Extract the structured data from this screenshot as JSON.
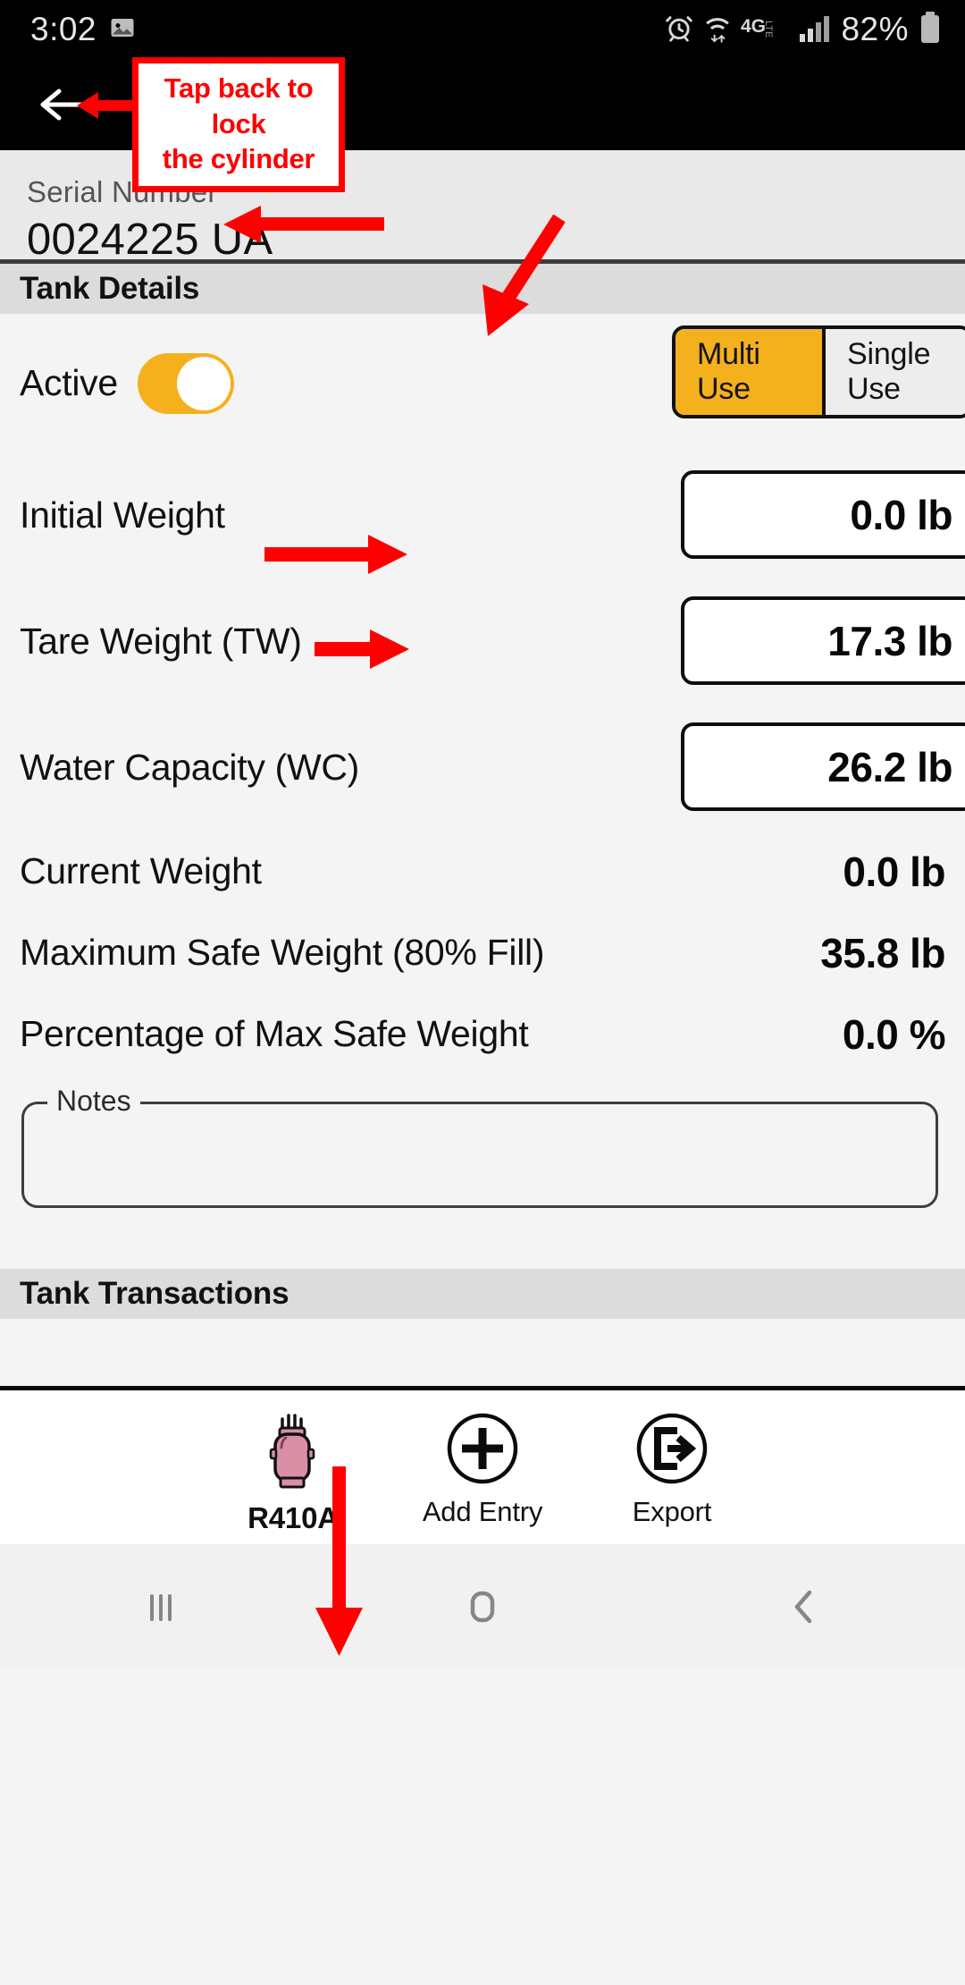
{
  "status_bar": {
    "time": "3:02",
    "battery_percent": "82%",
    "network": "4G LTE",
    "icons": [
      "image-icon",
      "alarm-icon",
      "wifi-icon",
      "network-4glte-icon",
      "signal-bars-icon",
      "battery-icon"
    ]
  },
  "app_bar": {
    "back_label": "back-arrow"
  },
  "annotations": {
    "callout_line1": "Tap back to lock",
    "callout_line2": "the cylinder",
    "callout_color": "#ff0000"
  },
  "serial": {
    "label": "Serial Number",
    "value": "0024225 UA"
  },
  "tank_details": {
    "header": "Tank Details",
    "active": {
      "label": "Active",
      "state": "on"
    },
    "use_type": {
      "selected": "Multi Use",
      "options": [
        "Multi Use",
        "Single Use"
      ]
    },
    "fields": [
      {
        "label": "Initial Weight",
        "value": "0.0 lb",
        "editable": true
      },
      {
        "label": "Tare Weight (TW)",
        "value": "17.3 lb",
        "editable": true
      },
      {
        "label": "Water Capacity (WC)",
        "value": "26.2 lb",
        "editable": true
      }
    ],
    "readonly": [
      {
        "label": "Current Weight",
        "value": "0.0 lb"
      },
      {
        "label": "Maximum Safe Weight (80% Fill)",
        "value": "35.8 lb"
      },
      {
        "label": "Percentage of Max Safe Weight",
        "value": "0.0 %"
      }
    ],
    "notes": {
      "legend": "Notes",
      "value": "",
      "placeholder": ""
    }
  },
  "tank_transactions": {
    "header": "Tank Transactions",
    "items": []
  },
  "action_bar": {
    "actions": [
      {
        "label": "R410A",
        "icon": "refrigerant-cylinder-icon"
      },
      {
        "label": "Add Entry",
        "icon": "plus-circle-icon"
      },
      {
        "label": "Export",
        "icon": "export-circle-icon"
      }
    ]
  },
  "nav_bar": {
    "recents": "recents-icon",
    "home": "home-icon",
    "back": "back-chevron-icon"
  },
  "colors": {
    "accent": "#F5B01E",
    "annotation": "#FF0000",
    "section_header_bg": "#DCDCDC",
    "page_bg": "#F4F4F4"
  }
}
